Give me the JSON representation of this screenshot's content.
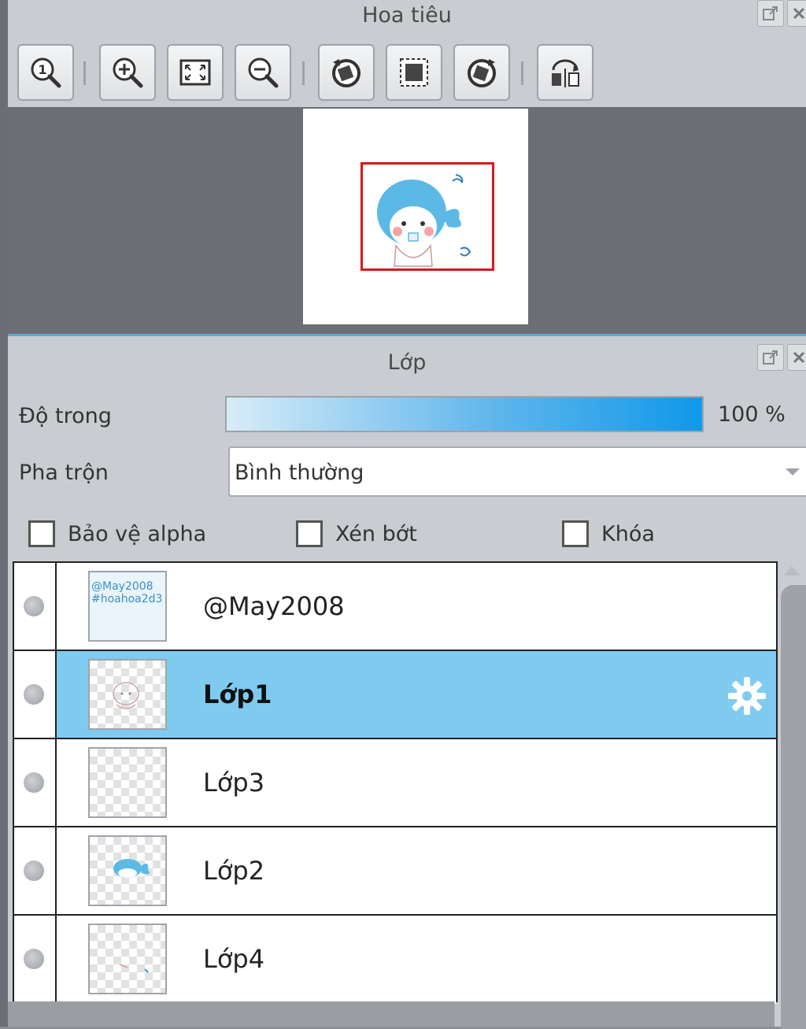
{
  "navigator": {
    "title": "Hoa tiêu",
    "toolbar": [
      {
        "name": "zoom-actual-size-icon"
      },
      {
        "name": "zoom-in-icon"
      },
      {
        "name": "fit-window-icon"
      },
      {
        "name": "zoom-out-icon"
      },
      {
        "name": "rotate-left-icon"
      },
      {
        "name": "reset-rotation-icon"
      },
      {
        "name": "rotate-right-icon"
      },
      {
        "name": "flip-horizontal-icon"
      }
    ],
    "frame_color": "#d8171e"
  },
  "layers_panel": {
    "title": "Lớp",
    "opacity": {
      "label": "Độ trong",
      "value": "100 %",
      "level_percent": 100
    },
    "blend": {
      "label": "Pha trộn",
      "value": "Bình thường"
    },
    "checkboxes": [
      {
        "label": "Bảo vệ alpha",
        "checked": false
      },
      {
        "label": "Xén bớt",
        "checked": false
      },
      {
        "label": "Khóa",
        "checked": false
      }
    ],
    "layers": [
      {
        "name": "@May2008",
        "selected": false,
        "thumb_text": "@May2008 #hoahoa2d3"
      },
      {
        "name": "Lớp1",
        "selected": true
      },
      {
        "name": "Lớp3",
        "selected": false
      },
      {
        "name": "Lớp2",
        "selected": false
      },
      {
        "name": "Lớp4",
        "selected": false
      }
    ],
    "accent_color": "#7fcbef"
  }
}
